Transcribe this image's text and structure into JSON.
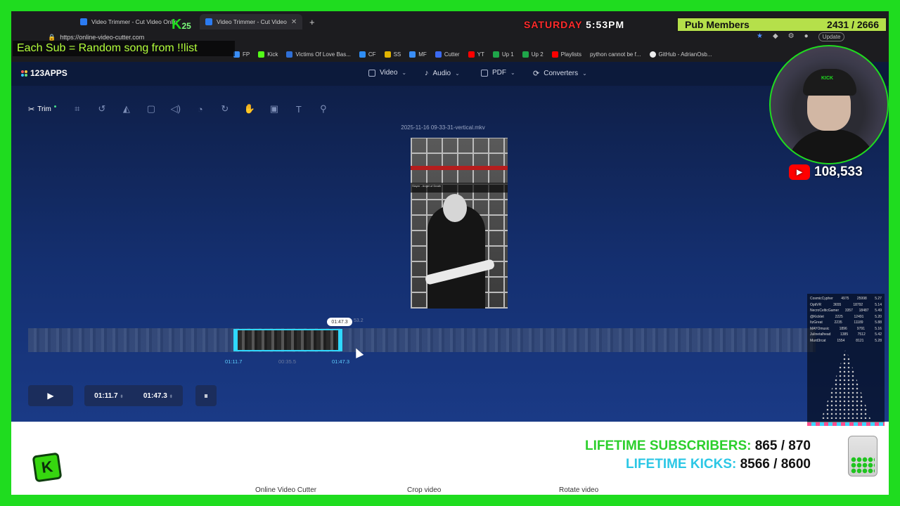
{
  "browser": {
    "tabs": [
      {
        "label": "Video Trimmer - Cut Video Onlin"
      },
      {
        "label": "Video Trimmer - Cut Video"
      }
    ],
    "new_tab": "+",
    "url": "https://online-video-cutter.com",
    "bookmarks": [
      "FP",
      "Kick",
      "Victims Of Love Bas...",
      "CF",
      "SS",
      "MF",
      "Cutter",
      "YT",
      "Up 1",
      "Up 2",
      "Playlists",
      "python cannot be f...",
      "GitHub - AdrianOsb..."
    ],
    "update_label": "Update"
  },
  "app": {
    "logo": "123APPS",
    "nav": [
      {
        "label": "Video"
      },
      {
        "label": "Audio"
      },
      {
        "label": "PDF"
      },
      {
        "label": "Converters"
      }
    ],
    "trim_label": "Trim",
    "filename": "2025-11-16 09-33-31-vertical.mkv",
    "video_overlay_text": "Slayer - Angel of Death",
    "timeline": {
      "playhead": "01:47.3",
      "ghost_time": "53.2",
      "start": "01:11.7",
      "mid": "00:35.5",
      "end": "01:47.3"
    },
    "controls": {
      "start_time": "01:11.7",
      "end_time": "01:47.3"
    }
  },
  "footer": {
    "links": [
      "Online Video Cutter",
      "Crop video",
      "Rotate video"
    ]
  },
  "overlay": {
    "day": "SATURDAY",
    "time": "5:53PM",
    "pub_label": "Pub Members",
    "pub_value": "2431 / 2666",
    "sub_banner": "Each Sub = Random song from !!list",
    "youtube_count": "108,533",
    "lifetime_subs_label": "LIFETIME SUBSCRIBERS:",
    "lifetime_subs_value": "865 / 870",
    "lifetime_kicks_label": "LIFETIME KICKS:",
    "lifetime_kicks_value": "8566 / 8600",
    "kick_k": "K",
    "kick_number": "25",
    "cap_text": "KICK",
    "leaderboard": [
      {
        "name": "CosmicCypher",
        "a": "4975",
        "b": "25998",
        "c": "5.27"
      },
      {
        "name": "OptiVR",
        "a": "3655",
        "b": "18792",
        "c": "5.14"
      },
      {
        "name": "NecroCelticGamer",
        "a": "3357",
        "b": "18487",
        "c": "5.49"
      },
      {
        "name": "@Kicklet",
        "a": "2225",
        "b": "12491",
        "c": "5.20"
      },
      {
        "name": "ItzGreat",
        "a": "2235",
        "b": "11189",
        "c": "5.88"
      },
      {
        "name": "MAYOmusic",
        "a": "1896",
        "b": "9791",
        "c": "5.16"
      },
      {
        "name": "Julinetalhead",
        "a": "1385",
        "b": "7512",
        "c": "5.42"
      },
      {
        "name": "Murd3rcat",
        "a": "1554",
        "b": "8121",
        "c": "5.28"
      }
    ]
  }
}
